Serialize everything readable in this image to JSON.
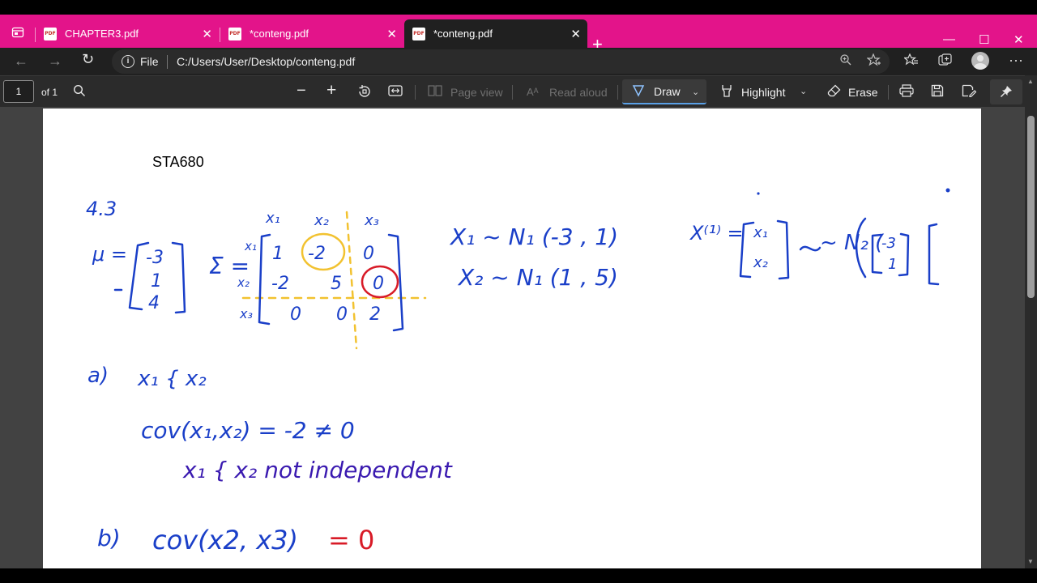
{
  "browser": {
    "tabs": [
      {
        "label": "CHAPTER3.pdf",
        "active": false
      },
      {
        "label": "*conteng.pdf",
        "active": false
      },
      {
        "label": "*conteng.pdf",
        "active": true
      }
    ],
    "pdf_icon_text": "PDF",
    "close_glyph": "✕",
    "new_tab_glyph": "+",
    "window_controls": {
      "minimize": "—",
      "maximize": "☐",
      "close": "✕"
    },
    "address": {
      "scheme_label": "File",
      "path": "C:/Users/User/Desktop/conteng.pdf",
      "info_glyph": "i"
    },
    "accent_color": "#e3148a"
  },
  "pdf_toolbar": {
    "page_number": "1",
    "page_count": "of 1",
    "page_view_label": "Page view",
    "read_aloud_label": "Read aloud",
    "draw_label": "Draw",
    "highlight_label": "Highlight",
    "erase_label": "Erase"
  },
  "document": {
    "title": "STA680",
    "ink_colors": {
      "blue": "#1a3fc8",
      "purple": "#3a1ab0",
      "yellow": "#f2c230",
      "red": "#d81b27"
    },
    "handwriting": {
      "problem_number": "4.3",
      "mu_label": "μ =",
      "mu_values": [
        "-3",
        "1",
        "4"
      ],
      "sigma_label": "Σ =",
      "sigma_col_headers": [
        "x₁",
        "x₂",
        "x₃"
      ],
      "sigma_row_headers": [
        "x₁",
        "x₂",
        "x₃"
      ],
      "sigma_rows": [
        [
          "1",
          "-2",
          "0"
        ],
        [
          "-2",
          "5",
          "0"
        ],
        [
          "0",
          "0",
          "2"
        ]
      ],
      "dist_x1": "X₁ ~ N₁ (-3 , 1)",
      "dist_x2": "X₂ ~ N₁ (1 , 5)",
      "vector_lhs": "X⁽¹⁾ =",
      "vector_entries": [
        "x₁",
        "x₂"
      ],
      "vector_dist": "~ N₂ (",
      "vector_mean": [
        "-3",
        "1"
      ],
      "part_a_label": "a)",
      "part_a_text": "x₁ { x₂",
      "part_a_cov": "cov(x₁,x₂) = -2 ≠ 0",
      "part_a_conclusion": "x₁ { x₂ not independent",
      "part_b_label": "b)",
      "part_b_cov": "cov(x2, x3)",
      "part_b_result": "= 0"
    }
  }
}
